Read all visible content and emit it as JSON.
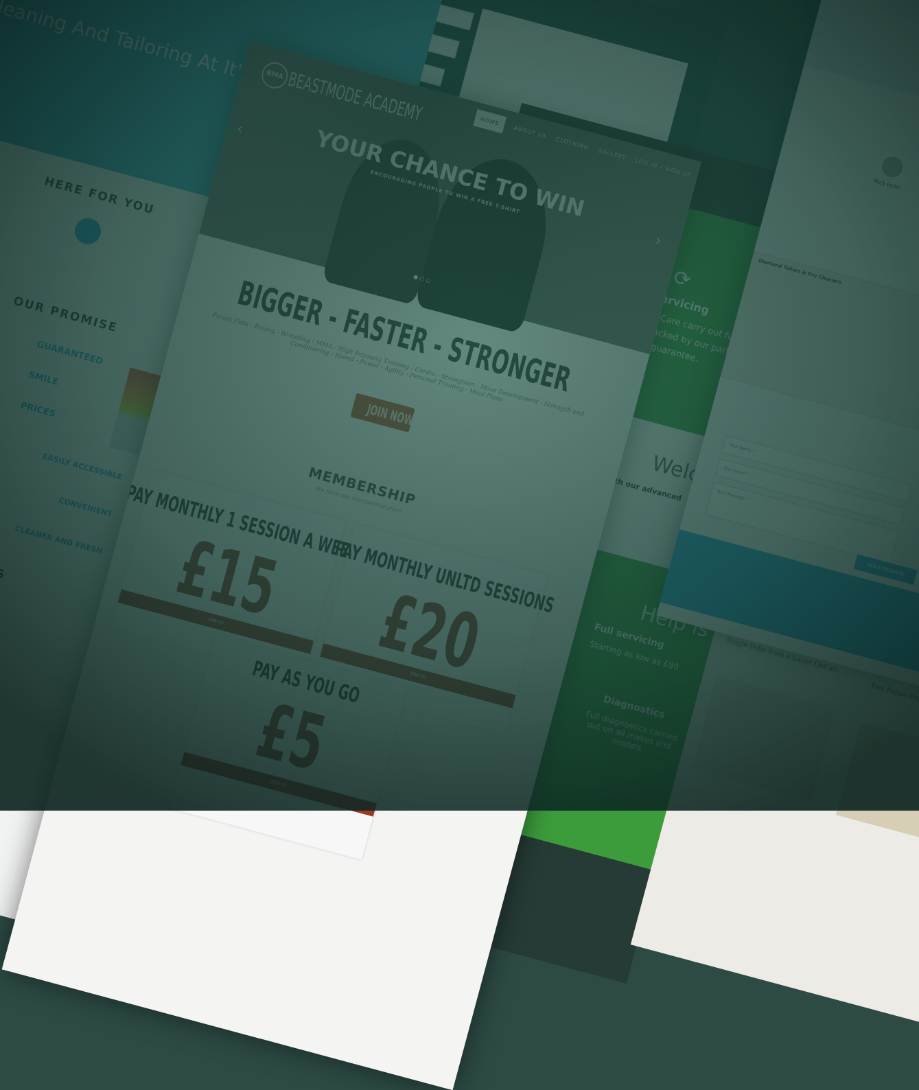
{
  "main_site": {
    "brand": "BEASTMODE ACADEMY",
    "logo_mark": "BMA",
    "nav": [
      "HOME",
      "ABOUT US",
      "CLOTHING",
      "GALLERY",
      "LOG IN / SIGN UP"
    ],
    "hero_title": "YOUR CHANCE TO WIN",
    "hero_subtitle": "ENCOURAGING PEOPLE TO WIN A FREE T-SHIRT",
    "headline": "BIGGER - FASTER - STRONGER",
    "tagline": "Forest Fists - Boxing - Wrestling - MMA - High Intensity Training - Cardio - Strongman - Mass Development - Strength and Conditioning - Speed - Power - Agility - Personal Training - Meal Plans",
    "join_button": "JOIN NOW",
    "membership_title": "MEMBERSHIP",
    "membership_subtitle": "We have two membership plans",
    "plans": [
      {
        "title": "PAY MONTHLY 1 SESSION A WEEK",
        "price": "£15",
        "note": "",
        "button": "JOIN US"
      },
      {
        "title": "PAY MONTHLY UNLTD SESSIONS",
        "price": "£20",
        "note": "",
        "button": "JOIN US"
      },
      {
        "title": "PAY AS YOU GO",
        "price": "£5",
        "note": "Per Session",
        "button": "JOIN US"
      }
    ],
    "colors": {
      "accent": "#9a3b26",
      "hero": "#5a5a55"
    }
  },
  "left_site": {
    "hero_title": "Dry Cleaning And Tailoring At It's Best",
    "section1": "HERE FOR YOU",
    "section2": "OUR PROMISE",
    "promises_left": [
      "GUARANTEED",
      "SMILE",
      "PRICES"
    ],
    "promises_right": [
      "EASILY ACCESSIBLE",
      "CONVENIENT",
      "CLEANER AND FRESH"
    ],
    "section3": "TESTIMONIALS",
    "colors": {
      "accent": "#2aa0d0"
    }
  },
  "green_site": {
    "service1": "Servicing",
    "service1_text": "Diamo AutoCare carry out full servicing backed by our parts and labour guarantee.",
    "welcome": "Welcome",
    "welcome_sub": "Expert hand with our advanced",
    "service2": "Full servicing",
    "service2_text": "Starting as low as £90",
    "help": "Help is at hand",
    "service3": "Diagnostics",
    "service3_text": "Full diagnostics carried out on all makes and models",
    "colors": {
      "accent": "#3c9c3c"
    }
  },
  "contact_site": {
    "reviewer": "Nick Fuller",
    "map_title": "Diamond Tailors & Dry Cleaners",
    "fields": [
      "Your Name *",
      "Your Email *",
      "Your Message *"
    ],
    "send_button": "SEND MESSAGE",
    "colors": {
      "footer": "#2aa0d0"
    }
  },
  "gallery_site": {
    "captions": [
      "Single Folio from a Large Qur'an",
      "Two Folios from the 'Blue Qur'an'"
    ]
  }
}
